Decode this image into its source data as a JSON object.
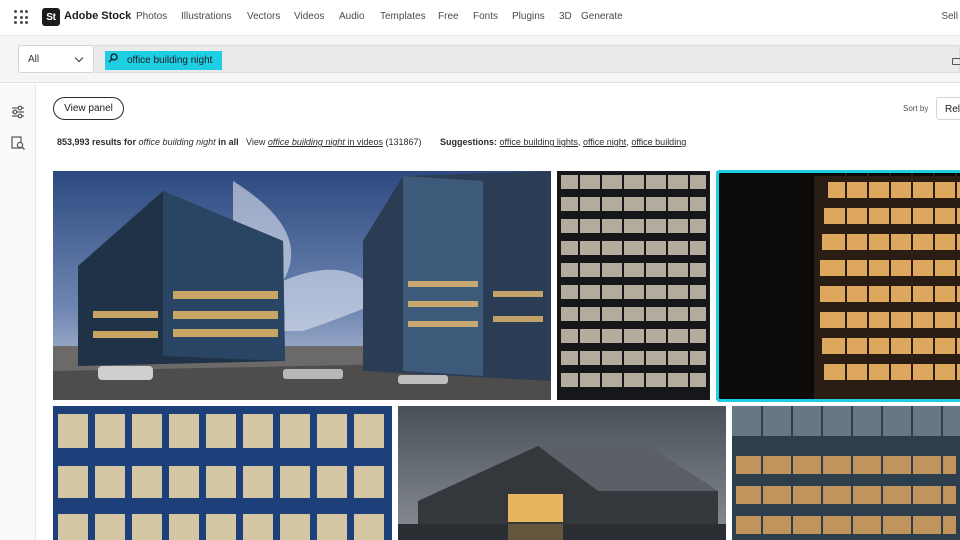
{
  "nav": {
    "logo_mark": "St",
    "brand": "Adobe Stock",
    "links": [
      "Photos",
      "Illustrations",
      "Vectors",
      "Videos",
      "Audio",
      "Templates",
      "Free",
      "Fonts",
      "Plugins",
      "3D",
      "Generate"
    ],
    "sell": "Sell"
  },
  "search": {
    "filter_value": "All",
    "query": "office building night"
  },
  "toolbar": {
    "view_panel": "View panel",
    "sort_by_label": "Sort by",
    "sort_value": "Rele"
  },
  "results": {
    "count": "853,993 results for ",
    "query_italic": "office building night",
    "in_all": " in all",
    "view_prefix": "View ",
    "view_link_query": "office building night",
    "view_link_suffix": " in videos",
    "video_count": " (131867)",
    "suggestions_label": "Suggestions:",
    "suggestions": [
      "office building lights",
      "office night",
      "office building"
    ]
  },
  "colors": {
    "accent": "#1ecfe4",
    "text": "#2c2c2c"
  }
}
